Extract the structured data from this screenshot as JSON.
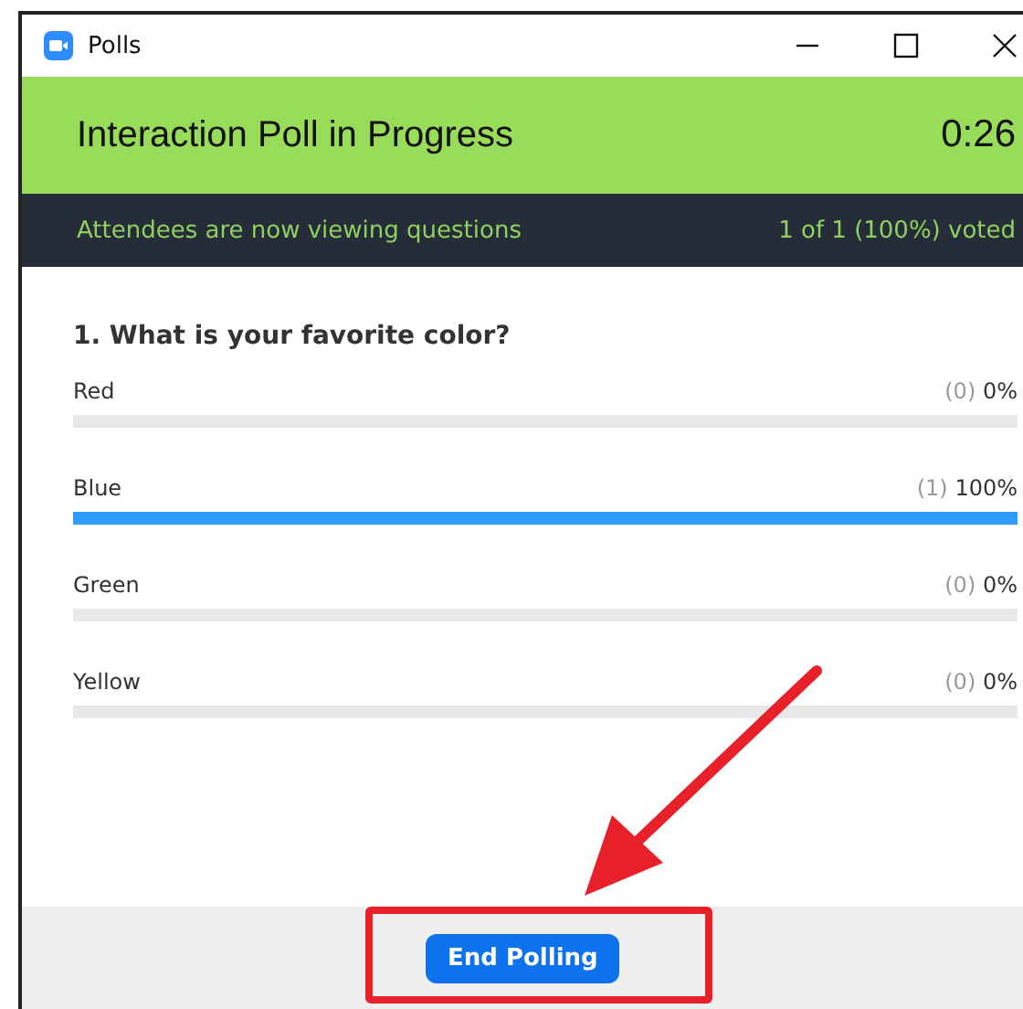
{
  "window": {
    "title": "Polls"
  },
  "header": {
    "title": "Interaction Poll  in Progress",
    "timer": "0:26"
  },
  "status_bar": {
    "message": "Attendees are now viewing questions",
    "votes": "1 of 1 (100%) voted"
  },
  "question": "1. What is your favorite color?",
  "options": [
    {
      "label": "Red",
      "count": "(0)",
      "percent": "0%",
      "level": 0
    },
    {
      "label": "Blue",
      "count": "(1)",
      "percent": "100%",
      "level": 1
    },
    {
      "label": "Green",
      "count": "(0)",
      "percent": "0%",
      "level": 0
    },
    {
      "label": "Yellow",
      "count": "(0)",
      "percent": "0%",
      "level": 0
    }
  ],
  "buttons": [
    {
      "label": "End Polling"
    }
  ]
}
